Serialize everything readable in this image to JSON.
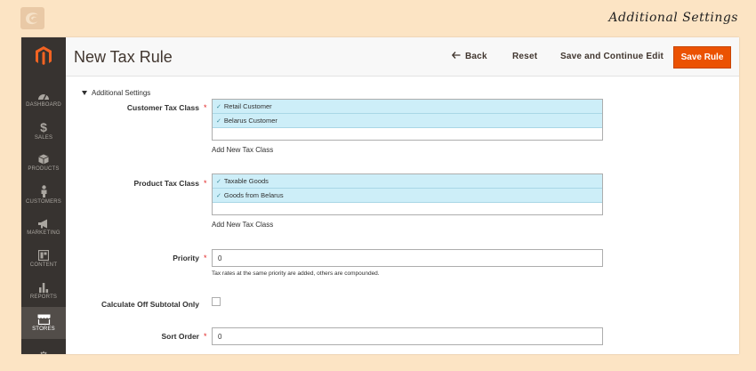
{
  "banner": {
    "title": "Additional Settings",
    "logo_icon": "brand-swirl-icon"
  },
  "sidebar": {
    "logo_icon": "magento-logo-icon",
    "items": [
      {
        "label": "DASHBOARD",
        "icon": "dashboard-icon",
        "active": false
      },
      {
        "label": "SALES",
        "icon": "dollar-icon",
        "active": false
      },
      {
        "label": "PRODUCTS",
        "icon": "cube-icon",
        "active": false
      },
      {
        "label": "CUSTOMERS",
        "icon": "person-icon",
        "active": false
      },
      {
        "label": "MARKETING",
        "icon": "megaphone-icon",
        "active": false
      },
      {
        "label": "CONTENT",
        "icon": "content-icon",
        "active": false
      },
      {
        "label": "REPORTS",
        "icon": "bar-chart-icon",
        "active": false
      },
      {
        "label": "STORES",
        "icon": "store-icon",
        "active": true
      },
      {
        "label": "",
        "icon": "gear-icon",
        "active": false
      }
    ]
  },
  "header": {
    "title": "New Tax Rule",
    "back_label": "Back",
    "reset_label": "Reset",
    "save_continue_label": "Save and Continue Edit",
    "save_rule_label": "Save Rule"
  },
  "section": {
    "title": "Additional Settings"
  },
  "form": {
    "customer_tax_class": {
      "label": "Customer Tax Class",
      "options": [
        "Retail Customer",
        "Belarus Customer"
      ],
      "add_link": "Add New Tax Class"
    },
    "product_tax_class": {
      "label": "Product Tax Class",
      "options": [
        "Taxable Goods",
        "Goods from Belarus"
      ],
      "add_link": "Add New Tax Class"
    },
    "priority": {
      "label": "Priority",
      "value": "0",
      "note": "Tax rates at the same priority are added, others are compounded."
    },
    "calculate_off_subtotal": {
      "label": "Calculate Off Subtotal Only",
      "checked": false
    },
    "sort_order": {
      "label": "Sort Order",
      "value": "0"
    }
  },
  "colors": {
    "accent": "#eb5202",
    "sidebar": "#373330",
    "selected_option": "#cdeef8",
    "required": "#e22626"
  }
}
